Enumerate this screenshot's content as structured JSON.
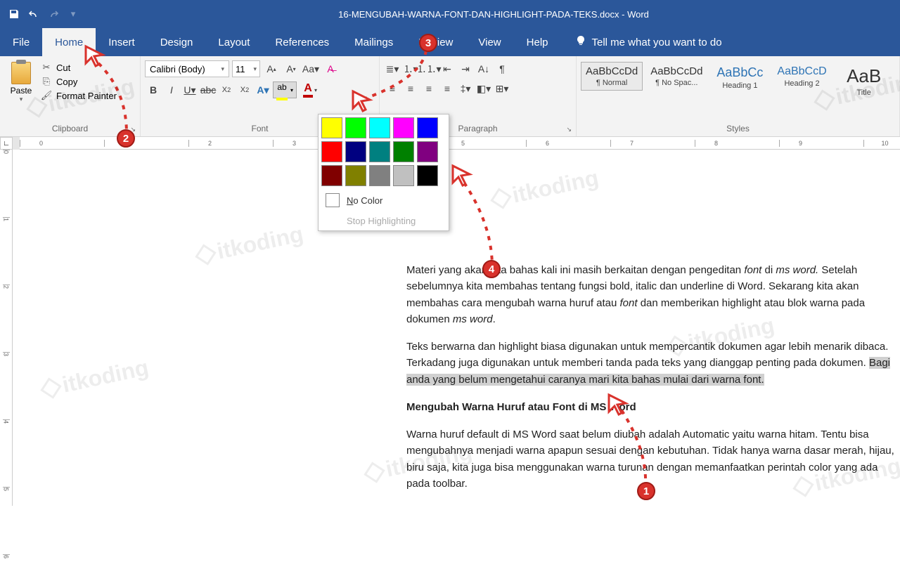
{
  "title_bar": {
    "title": "16-MENGUBAH-WARNA-FONT-DAN-HIGHLIGHT-PADA-TEKS.docx  -  Word"
  },
  "tabs": {
    "file": "File",
    "home": "Home",
    "insert": "Insert",
    "design": "Design",
    "layout": "Layout",
    "references": "References",
    "mailings": "Mailings",
    "review": "Review",
    "view": "View",
    "help": "Help",
    "tell_me": "Tell me what you want to do"
  },
  "clipboard": {
    "paste": "Paste",
    "cut": "Cut",
    "copy": "Copy",
    "format_painter": "Format Painter",
    "group_label": "Clipboard"
  },
  "font": {
    "name": "Calibri (Body)",
    "size": "11",
    "group_label": "Font"
  },
  "paragraph": {
    "group_label": "Paragraph"
  },
  "styles": {
    "group_label": "Styles",
    "items": [
      {
        "preview": "AaBbCcDd",
        "name": "¶ Normal"
      },
      {
        "preview": "AaBbCcDd",
        "name": "¶ No Spac..."
      },
      {
        "preview": "AaBbCc",
        "name": "Heading 1"
      },
      {
        "preview": "AaBbCcD",
        "name": "Heading 2"
      },
      {
        "preview": "AaB",
        "name": "Title"
      }
    ]
  },
  "highlight_dropdown": {
    "colors": [
      "#ffff00",
      "#00ff00",
      "#00ffff",
      "#ff00ff",
      "#0000ff",
      "#ff0000",
      "#000080",
      "#008080",
      "#008000",
      "#800080",
      "#800000",
      "#808000",
      "#808080",
      "#c0c0c0",
      "#000000"
    ],
    "no_color": "No Color",
    "stop": "Stop Highlighting"
  },
  "document": {
    "p1_a": "Materi yang akan kita bahas kali ini masih berkaitan dengan pengeditan ",
    "p1_b": " di ",
    "p1_c": " Setelah sebelumnya kita membahas tentang fungsi bold, italic dan underline di Word. Sekarang kita akan membahas cara mengubah warna huruf atau ",
    "p1_d": " dan memberikan highlight atau blok warna pada dokumen ",
    "font_i": "font",
    "msword_i": "ms word.",
    "msword_i2": "ms word",
    "p2_a": "Teks berwarna dan highlight biasa digunakan untuk mempercantik dokumen agar lebih menarik dibaca. Terkadang juga digunakan untuk memberi tanda pada teks yang dianggap penting pada dokumen. ",
    "p2_hl": "Bagi anda yang belum mengetahui caranya mari kita bahas mulai dari warna font.",
    "h1": "Mengubah Warna Huruf atau Font di MS Word",
    "p3": "Warna huruf default di MS Word saat belum diubah adalah Automatic yaitu warna hitam. Tentu bisa mengubahnya menjadi warna apapun sesuai dengan kebutuhan. Tidak hanya warna dasar merah, hijau, biru saja, kita juga bisa menggunakan warna turunan dengan memanfaatkan perintah color yang ada pada toolbar."
  },
  "markers": {
    "m1": "1",
    "m2": "2",
    "m3": "3",
    "m4": "4"
  },
  "watermark": "itkoding"
}
